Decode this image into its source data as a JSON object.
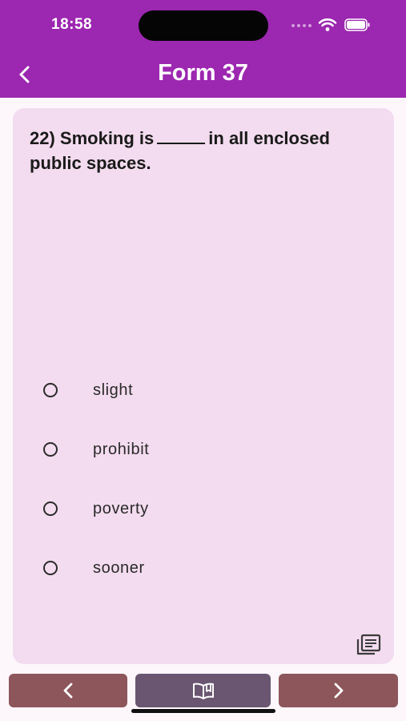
{
  "status_bar": {
    "time": "18:58"
  },
  "header": {
    "title": "Form 37",
    "back_icon": "chevron-left-icon",
    "background": "#9c27b0"
  },
  "question": {
    "prefix": "22) Smoking is",
    "suffix": "in all enclosed public spaces."
  },
  "options": [
    {
      "label": "slight",
      "selected": false
    },
    {
      "label": "prohibit",
      "selected": false
    },
    {
      "label": "poverty",
      "selected": false
    },
    {
      "label": "sooner",
      "selected": false
    }
  ],
  "card": {
    "background": "#f3dcef",
    "corner_icon": "list-view-icon"
  },
  "bottom_nav": {
    "prev_icon": "chevron-left-icon",
    "book_icon": "open-book-icon",
    "next_icon": "chevron-right-icon",
    "side_color": "#8d565b",
    "middle_color": "#6a5671"
  }
}
